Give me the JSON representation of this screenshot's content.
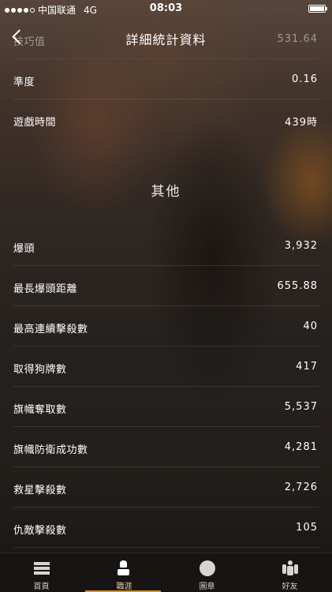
{
  "status_bar": {
    "carrier": "中国联通",
    "network": "4G",
    "time": "08:03",
    "signal_bars": 4,
    "battery_level": 1.0
  },
  "nav": {
    "title": "詳細統計資料",
    "back_icon": "chevron-left-icon"
  },
  "top_stats": [
    {
      "label": "技巧值",
      "value": "531.64"
    },
    {
      "label": "準度",
      "value": "0.16"
    },
    {
      "label": "遊戲時間",
      "value": "439時"
    }
  ],
  "other_section": {
    "title": "其他",
    "stats": [
      {
        "label": "爆頭",
        "value": "3,932"
      },
      {
        "label": "最長爆頭距離",
        "value": "655.88"
      },
      {
        "label": "最高連續擊殺數",
        "value": "40"
      },
      {
        "label": "取得狗牌數",
        "value": "417"
      },
      {
        "label": "旗幟奪取數",
        "value": "5,537"
      },
      {
        "label": "旗幟防衛成功數",
        "value": "4,281"
      },
      {
        "label": "救星擊殺數",
        "value": "2,726"
      },
      {
        "label": "仇敵擊殺數",
        "value": "105"
      }
    ]
  },
  "tab_bar": {
    "active": "career",
    "accent_color": "#c9933a",
    "tabs": [
      {
        "id": "home",
        "label": "首頁",
        "icon": "home-icon"
      },
      {
        "id": "career",
        "label": "職涯",
        "icon": "career-icon"
      },
      {
        "id": "medals",
        "label": "圖章",
        "icon": "medal-icon"
      },
      {
        "id": "friends",
        "label": "好友",
        "icon": "friends-icon"
      }
    ]
  }
}
